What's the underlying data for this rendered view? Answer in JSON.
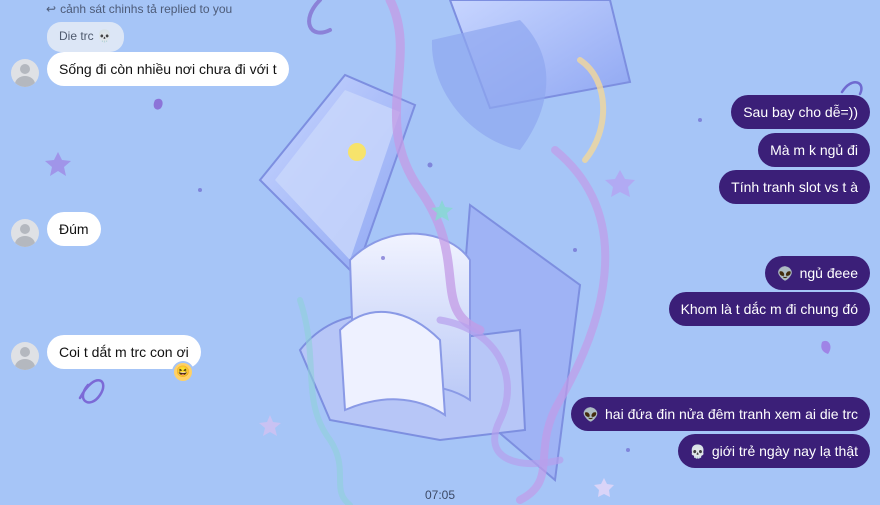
{
  "reply_header": "cảnh sát chinhs tả replied to you",
  "quoted_message": "Die trc",
  "quoted_emoji": "💀",
  "incoming": [
    {
      "text": "Sống đi còn nhiều nơi chưa đi với t"
    },
    {
      "text": "Đúm"
    },
    {
      "text": "Coi t dắt m trc con ơi"
    }
  ],
  "reaction_emoji": "😆",
  "outgoing": [
    {
      "text": "Sau bay cho dễ=))",
      "emoji": ""
    },
    {
      "text": "Mà m k ngủ đi",
      "emoji": ""
    },
    {
      "text": "Tính tranh slot vs t à",
      "emoji": ""
    },
    {
      "text": "ngủ đeee",
      "emoji": "👽"
    },
    {
      "text": "Khom là t dắc m đi chung đó",
      "emoji": ""
    },
    {
      "text": "hai đứa đin nửa đêm tranh xem ai die trc",
      "emoji": "👽"
    },
    {
      "text": "giới trẻ ngày nay lạ thật",
      "emoji": "💀"
    }
  ],
  "timestamp": "07:05",
  "colors": {
    "background": "#a6c5f7",
    "outgoing_bubble": "#3b1f78",
    "incoming_bubble": "#ffffff"
  }
}
